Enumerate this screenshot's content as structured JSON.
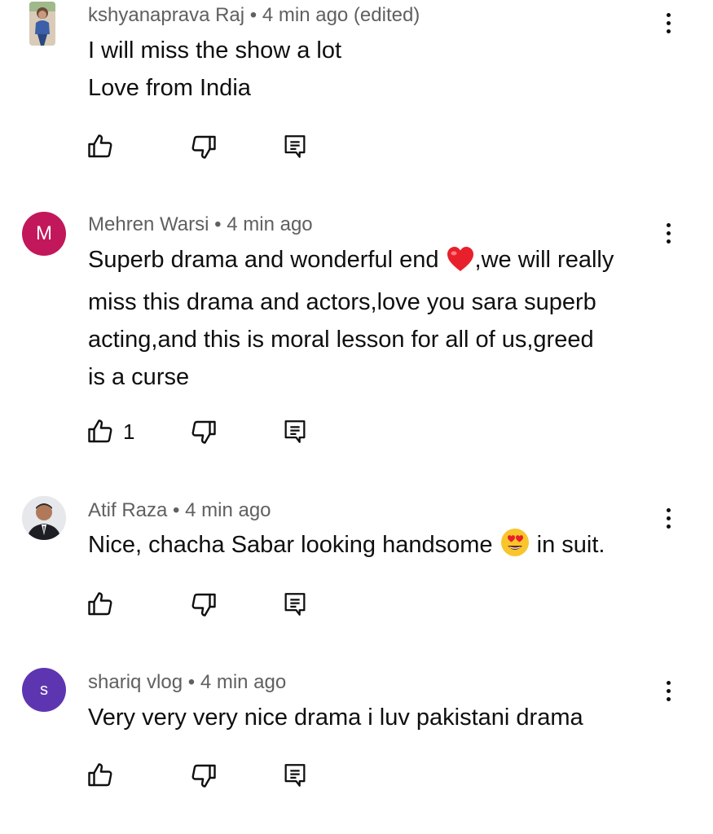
{
  "comments": [
    {
      "author": "kshyanaprava Raj",
      "time": "4 min ago (edited)",
      "lines": [
        "I will miss the show a lot",
        "Love from India"
      ],
      "likes": "",
      "avatar": {
        "type": "photo",
        "icon": "user-photo-icon"
      }
    },
    {
      "author": "Mehren Warsi",
      "time": "4 min ago",
      "lines": [
        "Superb drama and wonderful end",
        ",we will really",
        "miss this drama and actors,love you sara superb",
        "acting,and this is moral lesson for all of us,greed",
        "is a curse"
      ],
      "likes": "1",
      "avatar": {
        "type": "letter",
        "letter": "M",
        "color": "#c2185b"
      }
    },
    {
      "author": "Atif Raza",
      "time": "4 min ago",
      "lines": [
        "Nice, chacha Sabar looking handsome",
        "in suit."
      ],
      "likes": "",
      "avatar": {
        "type": "photo",
        "icon": "user-photo-icon"
      }
    },
    {
      "author": "shariq vlog",
      "time": "4 min ago",
      "lines": [
        "Very very very nice drama i luv pakistani drama"
      ],
      "likes": "",
      "avatar": {
        "type": "letter",
        "letter": "S",
        "color": "#5e35b1"
      }
    }
  ],
  "separator": " • ",
  "icons": {
    "like": "thumbs-up-icon",
    "dislike": "thumbs-down-icon",
    "reply": "reply-icon",
    "more": "more-vert-icon",
    "heart": "red-heart-emoji",
    "heart_eyes": "heart-eyes-emoji"
  },
  "colors": {
    "text": "#0f0f0f",
    "meta": "#606060",
    "avatar_m": "#c2185b",
    "avatar_s": "#5e35b1"
  }
}
